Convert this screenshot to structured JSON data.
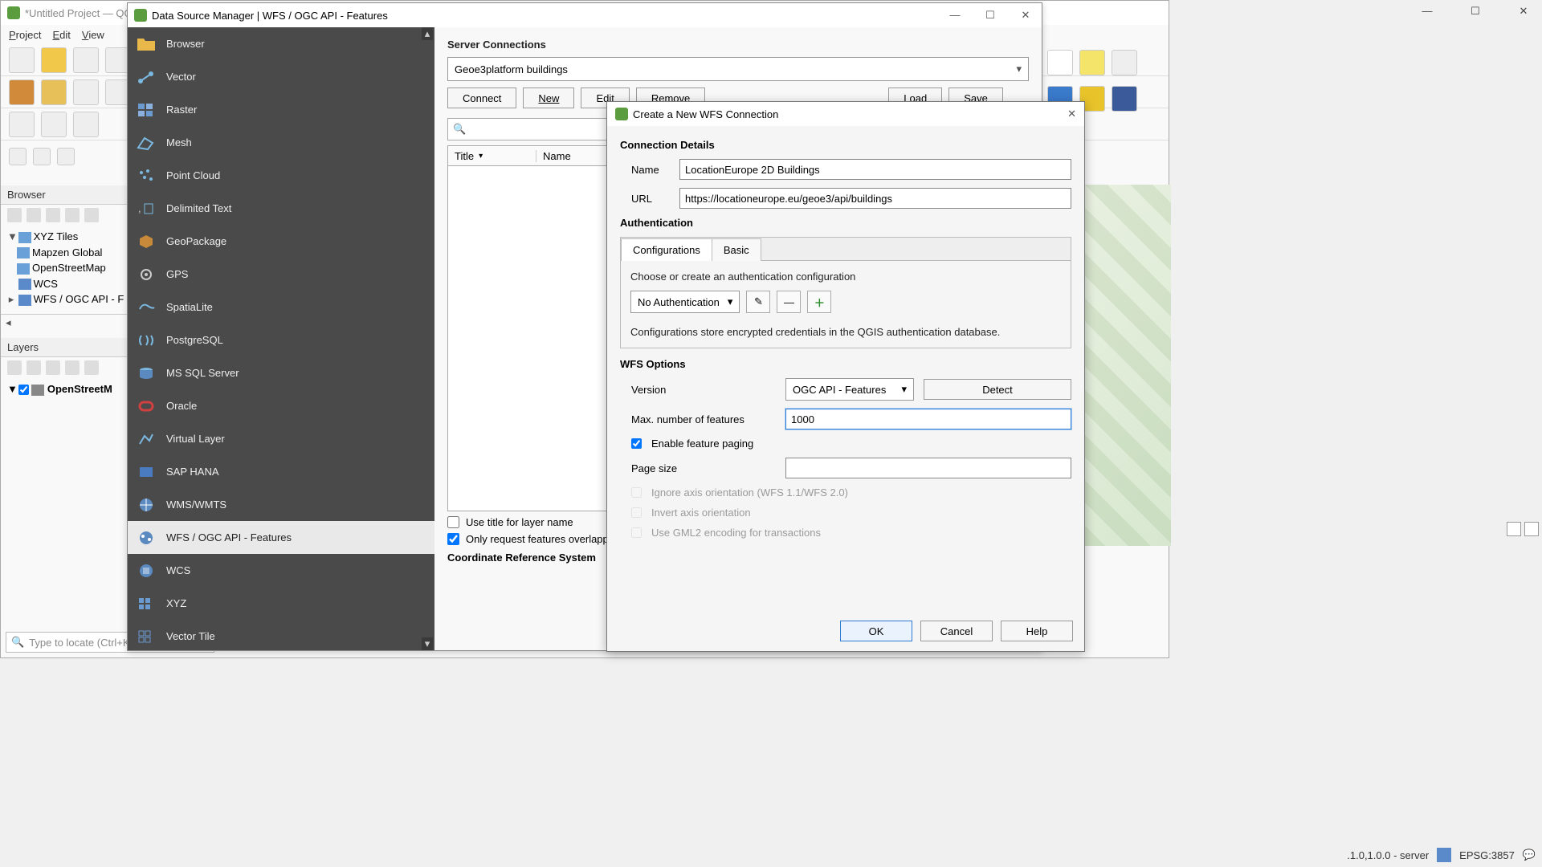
{
  "main_window": {
    "title": "*Untitled Project — QG",
    "menus": [
      "Project",
      "Edit",
      "View"
    ]
  },
  "browser_panel": {
    "title": "Browser",
    "items": [
      {
        "label": "XYZ Tiles",
        "expanded": true
      },
      {
        "label": "Mapzen Global"
      },
      {
        "label": "OpenStreetMap"
      },
      {
        "label": "WCS"
      },
      {
        "label": "WFS / OGC API - F"
      }
    ]
  },
  "layers_panel": {
    "title": "Layers",
    "layer": "OpenStreetM"
  },
  "locator_placeholder": "Type to locate (Ctrl+K",
  "statusbar": {
    "coords": ".1.0,1.0.0 - server",
    "epsg": "EPSG:3857"
  },
  "dsm": {
    "title": "Data Source Manager | WFS / OGC API - Features",
    "sidebar": [
      {
        "label": "Browser",
        "icon": "folder"
      },
      {
        "label": "Vector",
        "icon": "vector"
      },
      {
        "label": "Raster",
        "icon": "raster"
      },
      {
        "label": "Mesh",
        "icon": "mesh"
      },
      {
        "label": "Point Cloud",
        "icon": "pointcloud"
      },
      {
        "label": "Delimited Text",
        "icon": "csv"
      },
      {
        "label": "GeoPackage",
        "icon": "gpkg"
      },
      {
        "label": "GPS",
        "icon": "gps"
      },
      {
        "label": "SpatiaLite",
        "icon": "spatialite"
      },
      {
        "label": "PostgreSQL",
        "icon": "pg"
      },
      {
        "label": "MS SQL Server",
        "icon": "mssql"
      },
      {
        "label": "Oracle",
        "icon": "oracle"
      },
      {
        "label": "Virtual Layer",
        "icon": "virtual"
      },
      {
        "label": "SAP HANA",
        "icon": "hana"
      },
      {
        "label": "WMS/WMTS",
        "icon": "wms"
      },
      {
        "label": "WFS / OGC API - Features",
        "icon": "wfs",
        "selected": true
      },
      {
        "label": "WCS",
        "icon": "wcs"
      },
      {
        "label": "XYZ",
        "icon": "xyz"
      },
      {
        "label": "Vector Tile",
        "icon": "vtile"
      }
    ],
    "server_connections_title": "Server Connections",
    "selected_connection": "Geoe3platform buildings",
    "buttons": {
      "connect": "Connect",
      "new": "New",
      "edit": "Edit",
      "remove": "Remove",
      "load": "Load",
      "save": "Save"
    },
    "columns": {
      "title": "Title",
      "name": "Name"
    },
    "use_title": "Use title for layer name",
    "overlap": "Only request features overlapp",
    "crs_title": "Coordinate Reference System"
  },
  "wfs_dialog": {
    "title": "Create a New WFS Connection",
    "connection_details": "Connection Details",
    "name_label": "Name",
    "name_value": "LocationEurope 2D Buildings",
    "url_label": "URL",
    "url_value": "https://locationeurope.eu/geoe3/api/buildings",
    "authentication": "Authentication",
    "tabs": {
      "config": "Configurations",
      "basic": "Basic"
    },
    "auth_choose": "Choose or create an authentication configuration",
    "auth_select": "No Authentication",
    "auth_note": "Configurations store encrypted credentials in the QGIS authentication database.",
    "wfs_options": "WFS Options",
    "version_label": "Version",
    "version_value": "OGC API - Features",
    "detect": "Detect",
    "max_features_label": "Max. number of features",
    "max_features_value": "1000",
    "paging": "Enable feature paging",
    "page_size_label": "Page size",
    "page_size_value": "",
    "ignore_axis": "Ignore axis orientation (WFS 1.1/WFS 2.0)",
    "invert_axis": "Invert axis orientation",
    "gml2": "Use GML2 encoding for transactions",
    "buttons": {
      "ok": "OK",
      "cancel": "Cancel",
      "help": "Help"
    }
  }
}
